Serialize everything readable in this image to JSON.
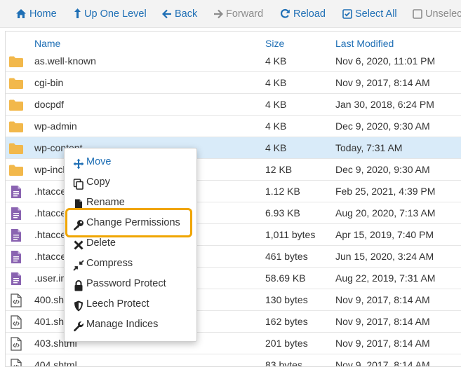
{
  "toolbar": {
    "home": "Home",
    "up_one_level": "Up One Level",
    "back": "Back",
    "forward": "Forward",
    "reload": "Reload",
    "select_all": "Select All",
    "unselect": "Unselec"
  },
  "table": {
    "headers": {
      "name": "Name",
      "size": "Size",
      "modified": "Last Modified"
    },
    "rows": [
      {
        "icon": "folder-icon",
        "name": "as.well-known",
        "size": "4 KB",
        "modified": "Nov 6, 2020, 11:01 PM"
      },
      {
        "icon": "folder-icon",
        "name": "cgi-bin",
        "size": "4 KB",
        "modified": "Nov 9, 2017, 8:14 AM"
      },
      {
        "icon": "folder-icon",
        "name": "docpdf",
        "size": "4 KB",
        "modified": "Jan 30, 2018, 6:24 PM"
      },
      {
        "icon": "folder-icon",
        "name": "wp-admin",
        "size": "4 KB",
        "modified": "Dec 9, 2020, 9:30 AM"
      },
      {
        "icon": "folder-icon",
        "name": "wp-content",
        "size": "4 KB",
        "modified": "Today, 7:31 AM",
        "selected": true
      },
      {
        "icon": "folder-icon",
        "name": "wp-inclu",
        "size": "12 KB",
        "modified": "Dec 9, 2020, 9:30 AM"
      },
      {
        "icon": "text-file-icon",
        "name": ".htacce",
        "size": "1.12 KB",
        "modified": "Feb 25, 2021, 4:39 PM"
      },
      {
        "icon": "text-file-icon",
        "name": ".htacce",
        "size": "6.93 KB",
        "modified": "Aug 20, 2020, 7:13 AM"
      },
      {
        "icon": "text-file-icon",
        "name": ".htacce",
        "size": "1,011 bytes",
        "modified": "Apr 15, 2019, 7:40 PM"
      },
      {
        "icon": "text-file-icon",
        "name": ".htacce",
        "size": "461 bytes",
        "modified": "Jun 15, 2020, 3:24 AM"
      },
      {
        "icon": "text-file-icon",
        "name": ".user.in",
        "size": "58.69 KB",
        "modified": "Aug 22, 2019, 7:31 AM"
      },
      {
        "icon": "code-file-icon",
        "name": "400.sh",
        "size": "130 bytes",
        "modified": "Nov 9, 2017, 8:14 AM"
      },
      {
        "icon": "code-file-icon",
        "name": "401.sh",
        "size": "162 bytes",
        "modified": "Nov 9, 2017, 8:14 AM"
      },
      {
        "icon": "code-file-icon",
        "name": "403.shtml",
        "size": "201 bytes",
        "modified": "Nov 9, 2017, 8:14 AM"
      },
      {
        "icon": "code-file-icon",
        "name": "404.shtml",
        "size": "83 bytes",
        "modified": "Nov 9, 2017, 8:14 AM"
      }
    ]
  },
  "context_menu": {
    "items": [
      {
        "icon": "move-icon",
        "label": "Move"
      },
      {
        "icon": "copy-icon",
        "label": "Copy"
      },
      {
        "icon": "file-icon",
        "label": "Rename"
      },
      {
        "icon": "key-icon",
        "label": "Change Permissions",
        "highlighted": true
      },
      {
        "icon": "close-icon",
        "label": "Delete"
      },
      {
        "icon": "compress-icon",
        "label": "Compress"
      },
      {
        "icon": "lock-icon",
        "label": "Password Protect"
      },
      {
        "icon": "shield-icon",
        "label": "Leech Protect"
      },
      {
        "icon": "wrench-icon",
        "label": "Manage Indices"
      }
    ]
  },
  "colors": {
    "accent": "#1f6fb5",
    "folder": "#f2b84b",
    "file": "#8a63b1",
    "selected_row": "#d9ebf9",
    "highlight": "#f0a500"
  }
}
